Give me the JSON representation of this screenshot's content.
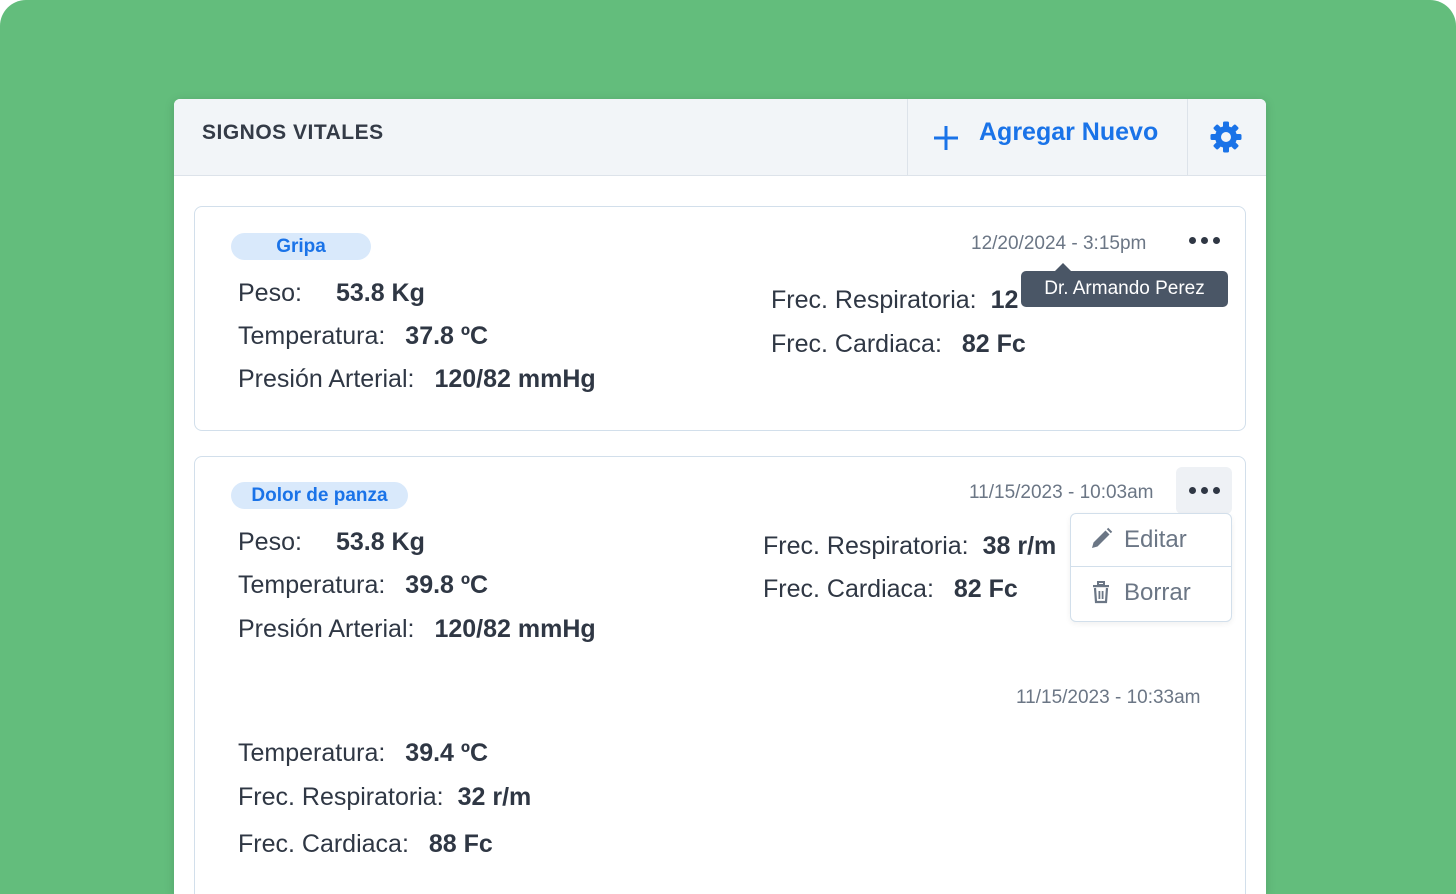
{
  "header": {
    "title": "SIGNOS VITALES",
    "add_label": "Agregar Nuevo",
    "accent_color": "#1a73e8"
  },
  "icons": [
    "plus-icon",
    "gear-icon",
    "more-icon",
    "pencil-icon",
    "trash-icon"
  ],
  "cards": [
    {
      "tag": "Gripa",
      "date": "12/20/2024 - 3:15pm",
      "tooltip": "Dr. Armando Perez",
      "left": [
        {
          "label": "Peso:",
          "value": "53.8 Kg"
        },
        {
          "label": "Temperatura:",
          "value": "37.8 ºC"
        },
        {
          "label": "Presión Arterial:",
          "value": "120/82 mmHg"
        }
      ],
      "right": [
        {
          "label": "Frec. Respiratoria:",
          "value": "12"
        },
        {
          "label": "Frec. Cardiaca:",
          "value": "82 Fc"
        }
      ]
    },
    {
      "tag": "Dolor de panza",
      "date": "11/15/2023 - 10:03am",
      "left": [
        {
          "label": "Peso:",
          "value": "53.8 Kg"
        },
        {
          "label": "Temperatura:",
          "value": "39.8 ºC"
        },
        {
          "label": "Presión Arterial:",
          "value": "120/82 mmHg"
        }
      ],
      "right": [
        {
          "label": "Frec. Respiratoria:",
          "value": "38 r/m"
        },
        {
          "label": "Frec. Cardiaca:",
          "value": "82 Fc"
        }
      ],
      "sub_entry": {
        "date": "11/15/2023 - 10:33am",
        "rows": [
          {
            "label": "Temperatura:",
            "value": "39.4 ºC"
          },
          {
            "label": "Frec. Respiratoria:",
            "value": "32 r/m"
          },
          {
            "label": "Frec. Cardiaca:",
            "value": "88 Fc"
          }
        ]
      }
    }
  ],
  "menu": {
    "edit_label": "Editar",
    "delete_label": "Borrar"
  }
}
